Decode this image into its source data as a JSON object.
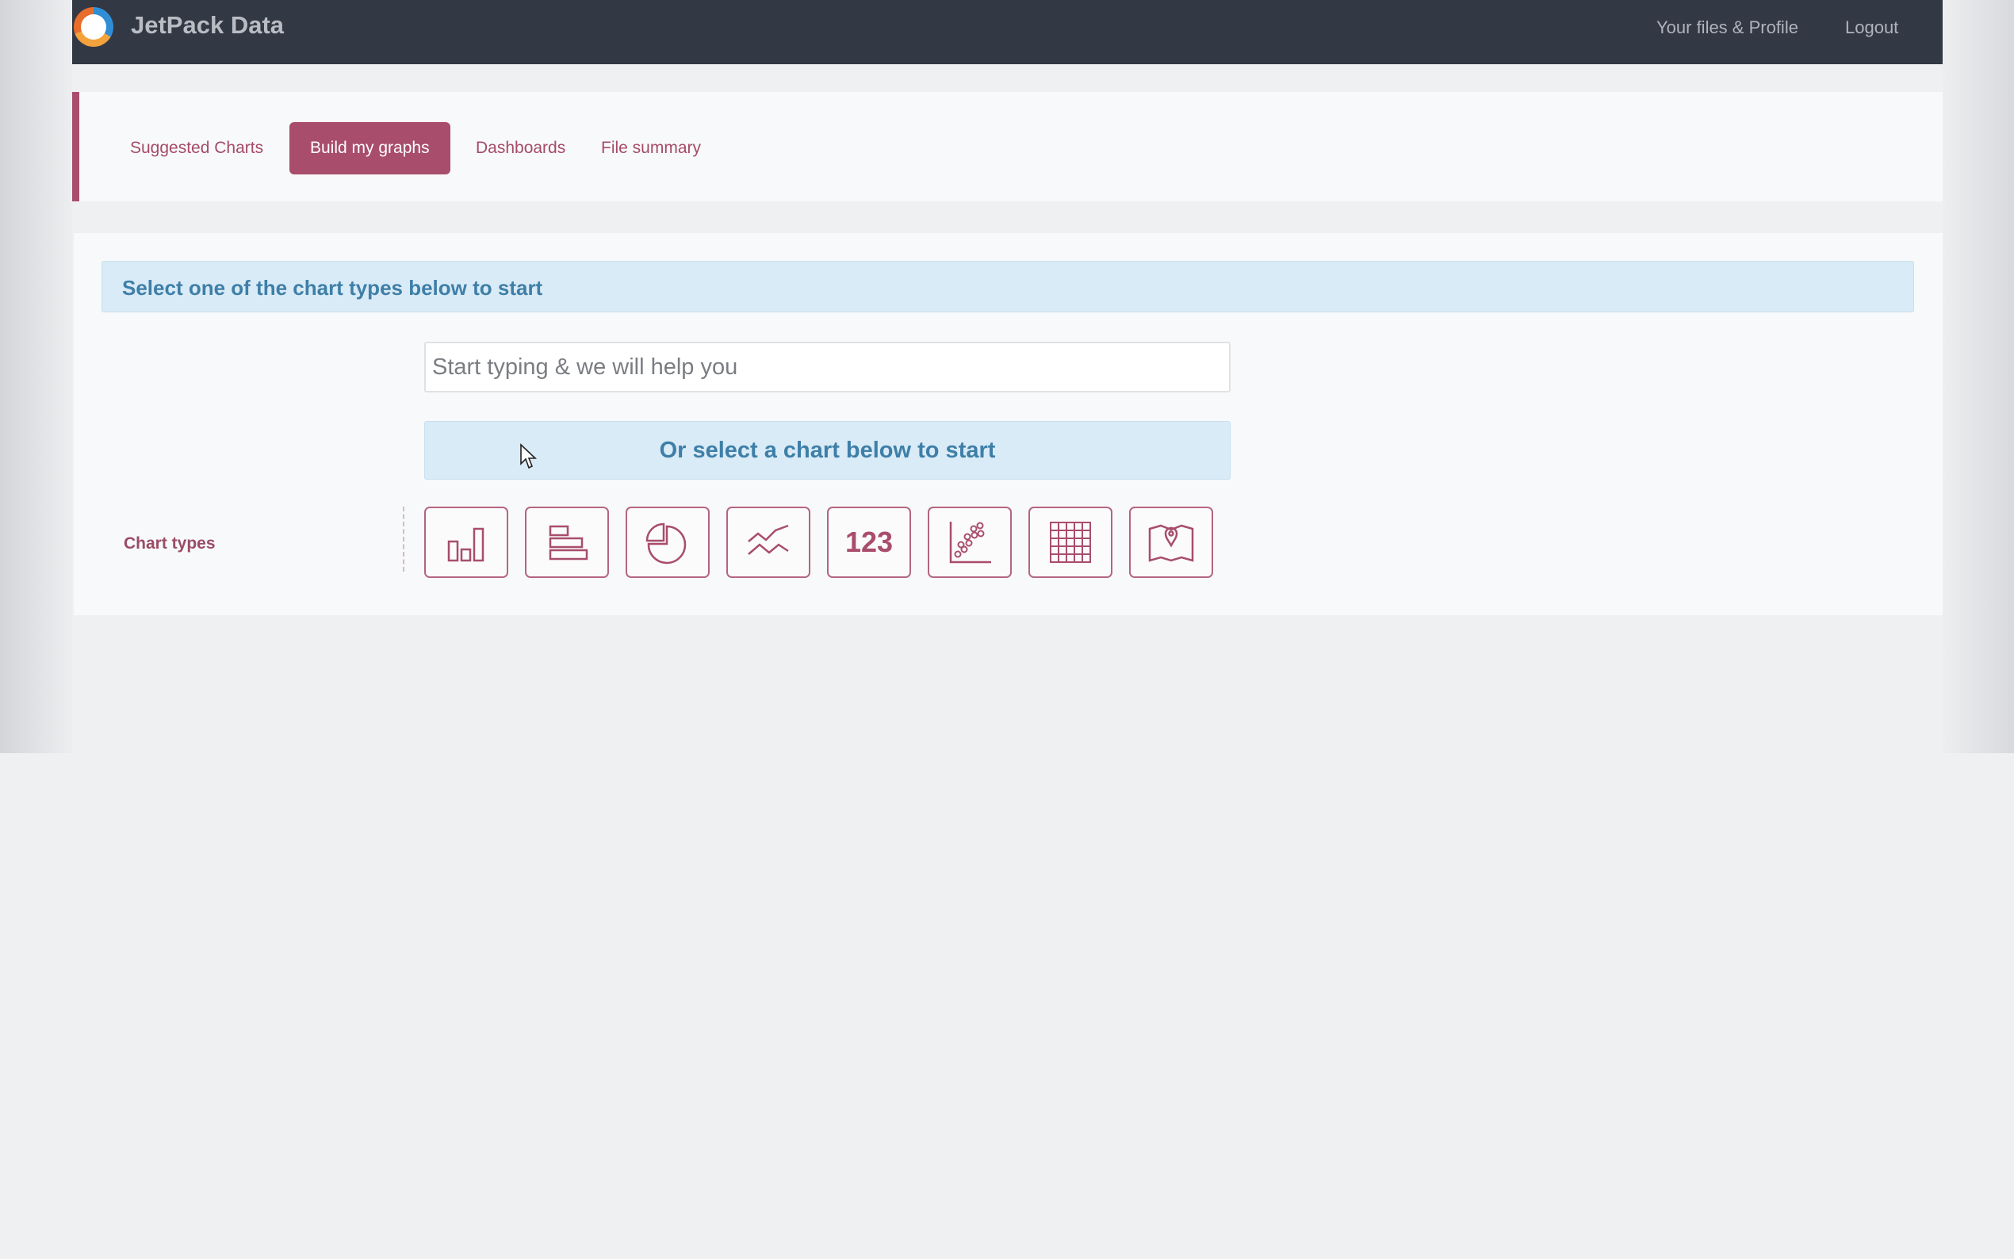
{
  "header": {
    "brand": "JetPack Data",
    "links": [
      "Your files & Profile",
      "Logout"
    ]
  },
  "tabs": [
    {
      "label": "Suggested Charts",
      "active": false
    },
    {
      "label": "Build my graphs",
      "active": true
    },
    {
      "label": "Dashboards",
      "active": false
    },
    {
      "label": "File summary",
      "active": false
    }
  ],
  "main": {
    "alert": "Select one of the chart types below to start",
    "search_placeholder": "Start typing & we will help you",
    "select_prompt": "Or select a chart below to start",
    "chart_types_label": "Chart types",
    "chart_types": [
      {
        "icon": "bar-chart-icon"
      },
      {
        "icon": "horizontal-bar-chart-icon"
      },
      {
        "icon": "pie-chart-icon"
      },
      {
        "icon": "line-chart-icon"
      },
      {
        "icon": "number-icon",
        "text": "123"
      },
      {
        "icon": "scatter-chart-icon"
      },
      {
        "icon": "table-icon"
      },
      {
        "icon": "map-icon"
      }
    ]
  },
  "colors": {
    "navbar": "#333845",
    "accent": "#a94d6c",
    "info_bg": "#d9ebf6",
    "info_text": "#3e7fa8"
  }
}
